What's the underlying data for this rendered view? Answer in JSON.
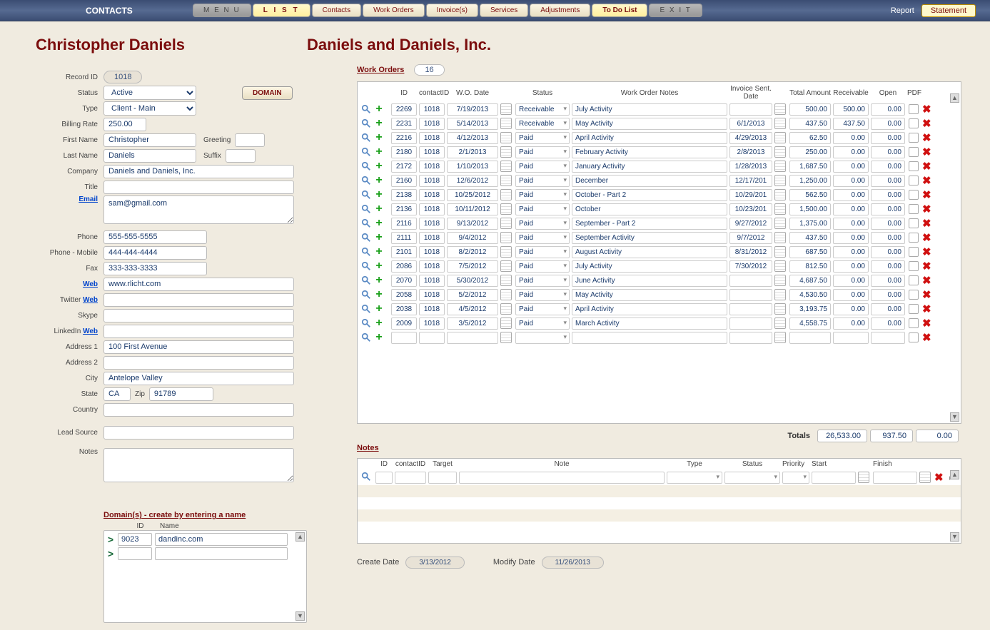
{
  "topbar": {
    "title": "CONTACTS",
    "menu": "M E N U",
    "list": "L I S T",
    "contacts": "Contacts",
    "work_orders": "Work Orders",
    "invoices": "Invoice(s)",
    "services": "Services",
    "adjustments": "Adjustments",
    "todo": "To Do List",
    "exit": "E X I T",
    "report": "Report",
    "statement": "Statement"
  },
  "headline": {
    "person": "Christopher Daniels",
    "company": "Daniels and Daniels, Inc."
  },
  "labels": {
    "record_id": "Record ID",
    "status": "Status",
    "type": "Type",
    "billing_rate": "Billing Rate",
    "first_name": "First Name",
    "last_name": "Last Name",
    "greeting": "Greeting",
    "suffix": "Suffix",
    "company": "Company",
    "title": "Title",
    "email": "Email",
    "phone": "Phone",
    "phone_mobile": "Phone - Mobile",
    "fax": "Fax",
    "web": "Web",
    "twitter": "Twitter",
    "skype": "Skype",
    "linkedin": "LinkedIn",
    "address1": "Address 1",
    "address2": "Address 2",
    "city": "City",
    "state": "State",
    "zip": "Zip",
    "country": "Country",
    "lead_source": "Lead Source",
    "notes": "Notes",
    "domain_btn": "DOMAIN",
    "domains_title": "Domain(s) - create by entering a name",
    "dom_id": "ID",
    "dom_name": "Name",
    "wo_title": "Work Orders",
    "notes_title": "Notes",
    "totals": "Totals",
    "create_date": "Create Date",
    "modify_date": "Modify Date"
  },
  "contact": {
    "record_id": "1018",
    "status": "Active",
    "type": "Client - Main",
    "billing_rate": "250.00",
    "first_name": "Christopher",
    "last_name": "Daniels",
    "greeting": "",
    "suffix": "",
    "company": "Daniels and Daniels, Inc.",
    "title": "",
    "email": "sam@gmail.com",
    "phone": "555-555-5555",
    "phone_mobile": "444-444-4444",
    "fax": "333-333-3333",
    "web": "www.rlicht.com",
    "twitter": "",
    "skype": "",
    "linkedin": "",
    "address1": "100 First Avenue",
    "address2": "",
    "city": "Antelope Valley",
    "state": "CA",
    "zip": "91789",
    "country": "",
    "lead_source": "",
    "notes": "",
    "create_date": "3/13/2012",
    "modify_date": "11/26/2013"
  },
  "domains": [
    {
      "id": "9023",
      "name": "dandinc.com"
    },
    {
      "id": "",
      "name": ""
    }
  ],
  "wo_count": "16",
  "wo_headers": {
    "id": "ID",
    "cid": "contactID",
    "date": "W.O. Date",
    "status": "Status",
    "notes": "Work Order Notes",
    "inv": "Invoice Sent. Date",
    "amt": "Total Amount",
    "rcv": "Receivable",
    "open": "Open",
    "pdf": "PDF"
  },
  "work_orders": [
    {
      "id": "2269",
      "cid": "1018",
      "date": "7/19/2013",
      "status": "Receivable",
      "notes": "July Activity",
      "inv": "",
      "amt": "500.00",
      "rcv": "500.00",
      "open": "0.00"
    },
    {
      "id": "2231",
      "cid": "1018",
      "date": "5/14/2013",
      "status": "Receivable",
      "notes": "May Activity",
      "inv": "6/1/2013",
      "amt": "437.50",
      "rcv": "437.50",
      "open": "0.00"
    },
    {
      "id": "2216",
      "cid": "1018",
      "date": "4/12/2013",
      "status": "Paid",
      "notes": "April Activity",
      "inv": "4/29/2013",
      "amt": "62.50",
      "rcv": "0.00",
      "open": "0.00"
    },
    {
      "id": "2180",
      "cid": "1018",
      "date": "2/1/2013",
      "status": "Paid",
      "notes": "February Activity",
      "inv": "2/8/2013",
      "amt": "250.00",
      "rcv": "0.00",
      "open": "0.00"
    },
    {
      "id": "2172",
      "cid": "1018",
      "date": "1/10/2013",
      "status": "Paid",
      "notes": "January Activity",
      "inv": "1/28/2013",
      "amt": "1,687.50",
      "rcv": "0.00",
      "open": "0.00"
    },
    {
      "id": "2160",
      "cid": "1018",
      "date": "12/6/2012",
      "status": "Paid",
      "notes": "December",
      "inv": "12/17/201",
      "amt": "1,250.00",
      "rcv": "0.00",
      "open": "0.00"
    },
    {
      "id": "2138",
      "cid": "1018",
      "date": "10/25/2012",
      "status": "Paid",
      "notes": "October - Part 2",
      "inv": "10/29/201",
      "amt": "562.50",
      "rcv": "0.00",
      "open": "0.00"
    },
    {
      "id": "2136",
      "cid": "1018",
      "date": "10/11/2012",
      "status": "Paid",
      "notes": "October",
      "inv": "10/23/201",
      "amt": "1,500.00",
      "rcv": "0.00",
      "open": "0.00"
    },
    {
      "id": "2116",
      "cid": "1018",
      "date": "9/13/2012",
      "status": "Paid",
      "notes": "September - Part 2",
      "inv": "9/27/2012",
      "amt": "1,375.00",
      "rcv": "0.00",
      "open": "0.00"
    },
    {
      "id": "2111",
      "cid": "1018",
      "date": "9/4/2012",
      "status": "Paid",
      "notes": "September Activity",
      "inv": "9/7/2012",
      "amt": "437.50",
      "rcv": "0.00",
      "open": "0.00"
    },
    {
      "id": "2101",
      "cid": "1018",
      "date": "8/2/2012",
      "status": "Paid",
      "notes": "August Activity",
      "inv": "8/31/2012",
      "amt": "687.50",
      "rcv": "0.00",
      "open": "0.00"
    },
    {
      "id": "2086",
      "cid": "1018",
      "date": "7/5/2012",
      "status": "Paid",
      "notes": "July Activity",
      "inv": "7/30/2012",
      "amt": "812.50",
      "rcv": "0.00",
      "open": "0.00"
    },
    {
      "id": "2070",
      "cid": "1018",
      "date": "5/30/2012",
      "status": "Paid",
      "notes": "June Activity",
      "inv": "",
      "amt": "4,687.50",
      "rcv": "0.00",
      "open": "0.00"
    },
    {
      "id": "2058",
      "cid": "1018",
      "date": "5/2/2012",
      "status": "Paid",
      "notes": "May Activity",
      "inv": "",
      "amt": "4,530.50",
      "rcv": "0.00",
      "open": "0.00"
    },
    {
      "id": "2038",
      "cid": "1018",
      "date": "4/5/2012",
      "status": "Paid",
      "notes": "April Activity",
      "inv": "",
      "amt": "3,193.75",
      "rcv": "0.00",
      "open": "0.00"
    },
    {
      "id": "2009",
      "cid": "1018",
      "date": "3/5/2012",
      "status": "Paid",
      "notes": "March Activity",
      "inv": "",
      "amt": "4,558.75",
      "rcv": "0.00",
      "open": "0.00"
    },
    {
      "id": "",
      "cid": "",
      "date": "",
      "status": "",
      "notes": "",
      "inv": "",
      "amt": "",
      "rcv": "",
      "open": ""
    }
  ],
  "totals": {
    "amt": "26,533.00",
    "rcv": "937.50",
    "open": "0.00"
  },
  "note_headers": {
    "id": "ID",
    "cid": "contactID",
    "tgt": "Target",
    "note": "Note",
    "type": "Type",
    "status": "Status",
    "pri": "Priority",
    "start": "Start",
    "finish": "Finish"
  }
}
